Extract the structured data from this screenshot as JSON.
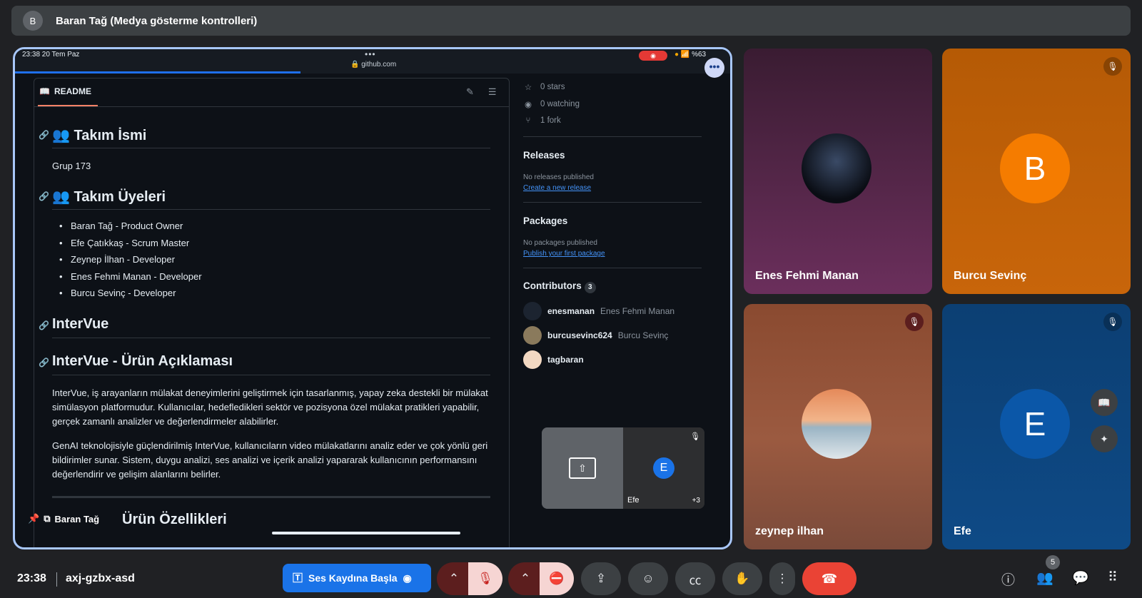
{
  "presenter_bar": {
    "avatar_initial": "B",
    "title": "Baran Tağ (Medya gösterme kontrolleri)"
  },
  "ios": {
    "time": "23:38   20 Tem Paz",
    "dots": "•••",
    "url": "🔒 github.com",
    "record_indicator": "◉",
    "battery": "%63",
    "more": "•••"
  },
  "readme": {
    "tab_label": "README",
    "tab_icon": "book-icon",
    "edit_icon": "✎",
    "list_icon": "☰",
    "h_team_name": "👥 Takım İsmi",
    "team_name": "Grup 173",
    "h_members": "👥 Takım Üyeleri",
    "members": [
      "Baran Tağ - Product Owner",
      "Efe Çatıkkaş - Scrum Master",
      "Zeynep İlhan - Developer",
      "Enes Fehmi Manan - Developer",
      "Burcu Sevinç - Developer"
    ],
    "h_intervue": "InterVue",
    "h_desc": "InterVue - Ürün Açıklaması",
    "desc_p1": "InterVue, iş arayanların mülakat deneyimlerini geliştirmek için tasarlanmış, yapay zeka destekli bir mülakat simülasyon platformudur. Kullanıcılar, hedefledikleri sektör ve pozisyona özel mülakat pratikleri yapabilir, gerçek zamanlı analizler ve değerlendirmeler alabilirler.",
    "desc_p2": "GenAI teknolojisiyle güçlendirilmiş InterVue, kullanıcıların video mülakatlarını analiz eder ve çok yönlü geri bildirimler sunar. Sistem, duygu analizi, ses analizi ve içerik analizi yapararak kullanıcının performansını değerlendirir ve gelişim alanlarını belirler.",
    "h_features": "Ürün Özellikleri",
    "overlay_name": "Baran Tağ"
  },
  "gh_sidebar": {
    "stars": "0 stars",
    "watching": "0 watching",
    "forks": "1 fork",
    "releases_h": "Releases",
    "releases_none": "No releases published",
    "releases_link": "Create a new release",
    "packages_h": "Packages",
    "packages_none": "No packages published",
    "packages_link": "Publish your first package",
    "contributors_h": "Contributors",
    "contributors_count": "3",
    "contributors": [
      {
        "user": "enesmanan",
        "name": "Enes Fehmi Manan"
      },
      {
        "user": "burcusevinc624",
        "name": "Burcu Sevinç"
      },
      {
        "user": "tagbaran",
        "name": ""
      }
    ]
  },
  "mini_panel": {
    "initial": "E",
    "name": "Efe",
    "more": "+3"
  },
  "tiles": [
    {
      "name": "Enes Fehmi Manan",
      "initial": "",
      "muted": false,
      "color": "#4a2240"
    },
    {
      "name": "Burcu Sevinç",
      "initial": "B",
      "muted": true,
      "color": "#f57c00"
    },
    {
      "name": "zeynep ilhan",
      "initial": "",
      "muted": true,
      "color": "#7a3b2a"
    },
    {
      "name": "Efe",
      "initial": "E",
      "muted": true,
      "color": "#0b57a8"
    }
  ],
  "bottom": {
    "clock": "23:38",
    "meeting_code": "axj-gzbx-asd",
    "record_label": "Ses Kaydına Başla",
    "participants_badge": "5"
  },
  "colors": {
    "accent": "#1a73e8",
    "end_call": "#ea4335",
    "share_border": "#a8c7fa"
  }
}
